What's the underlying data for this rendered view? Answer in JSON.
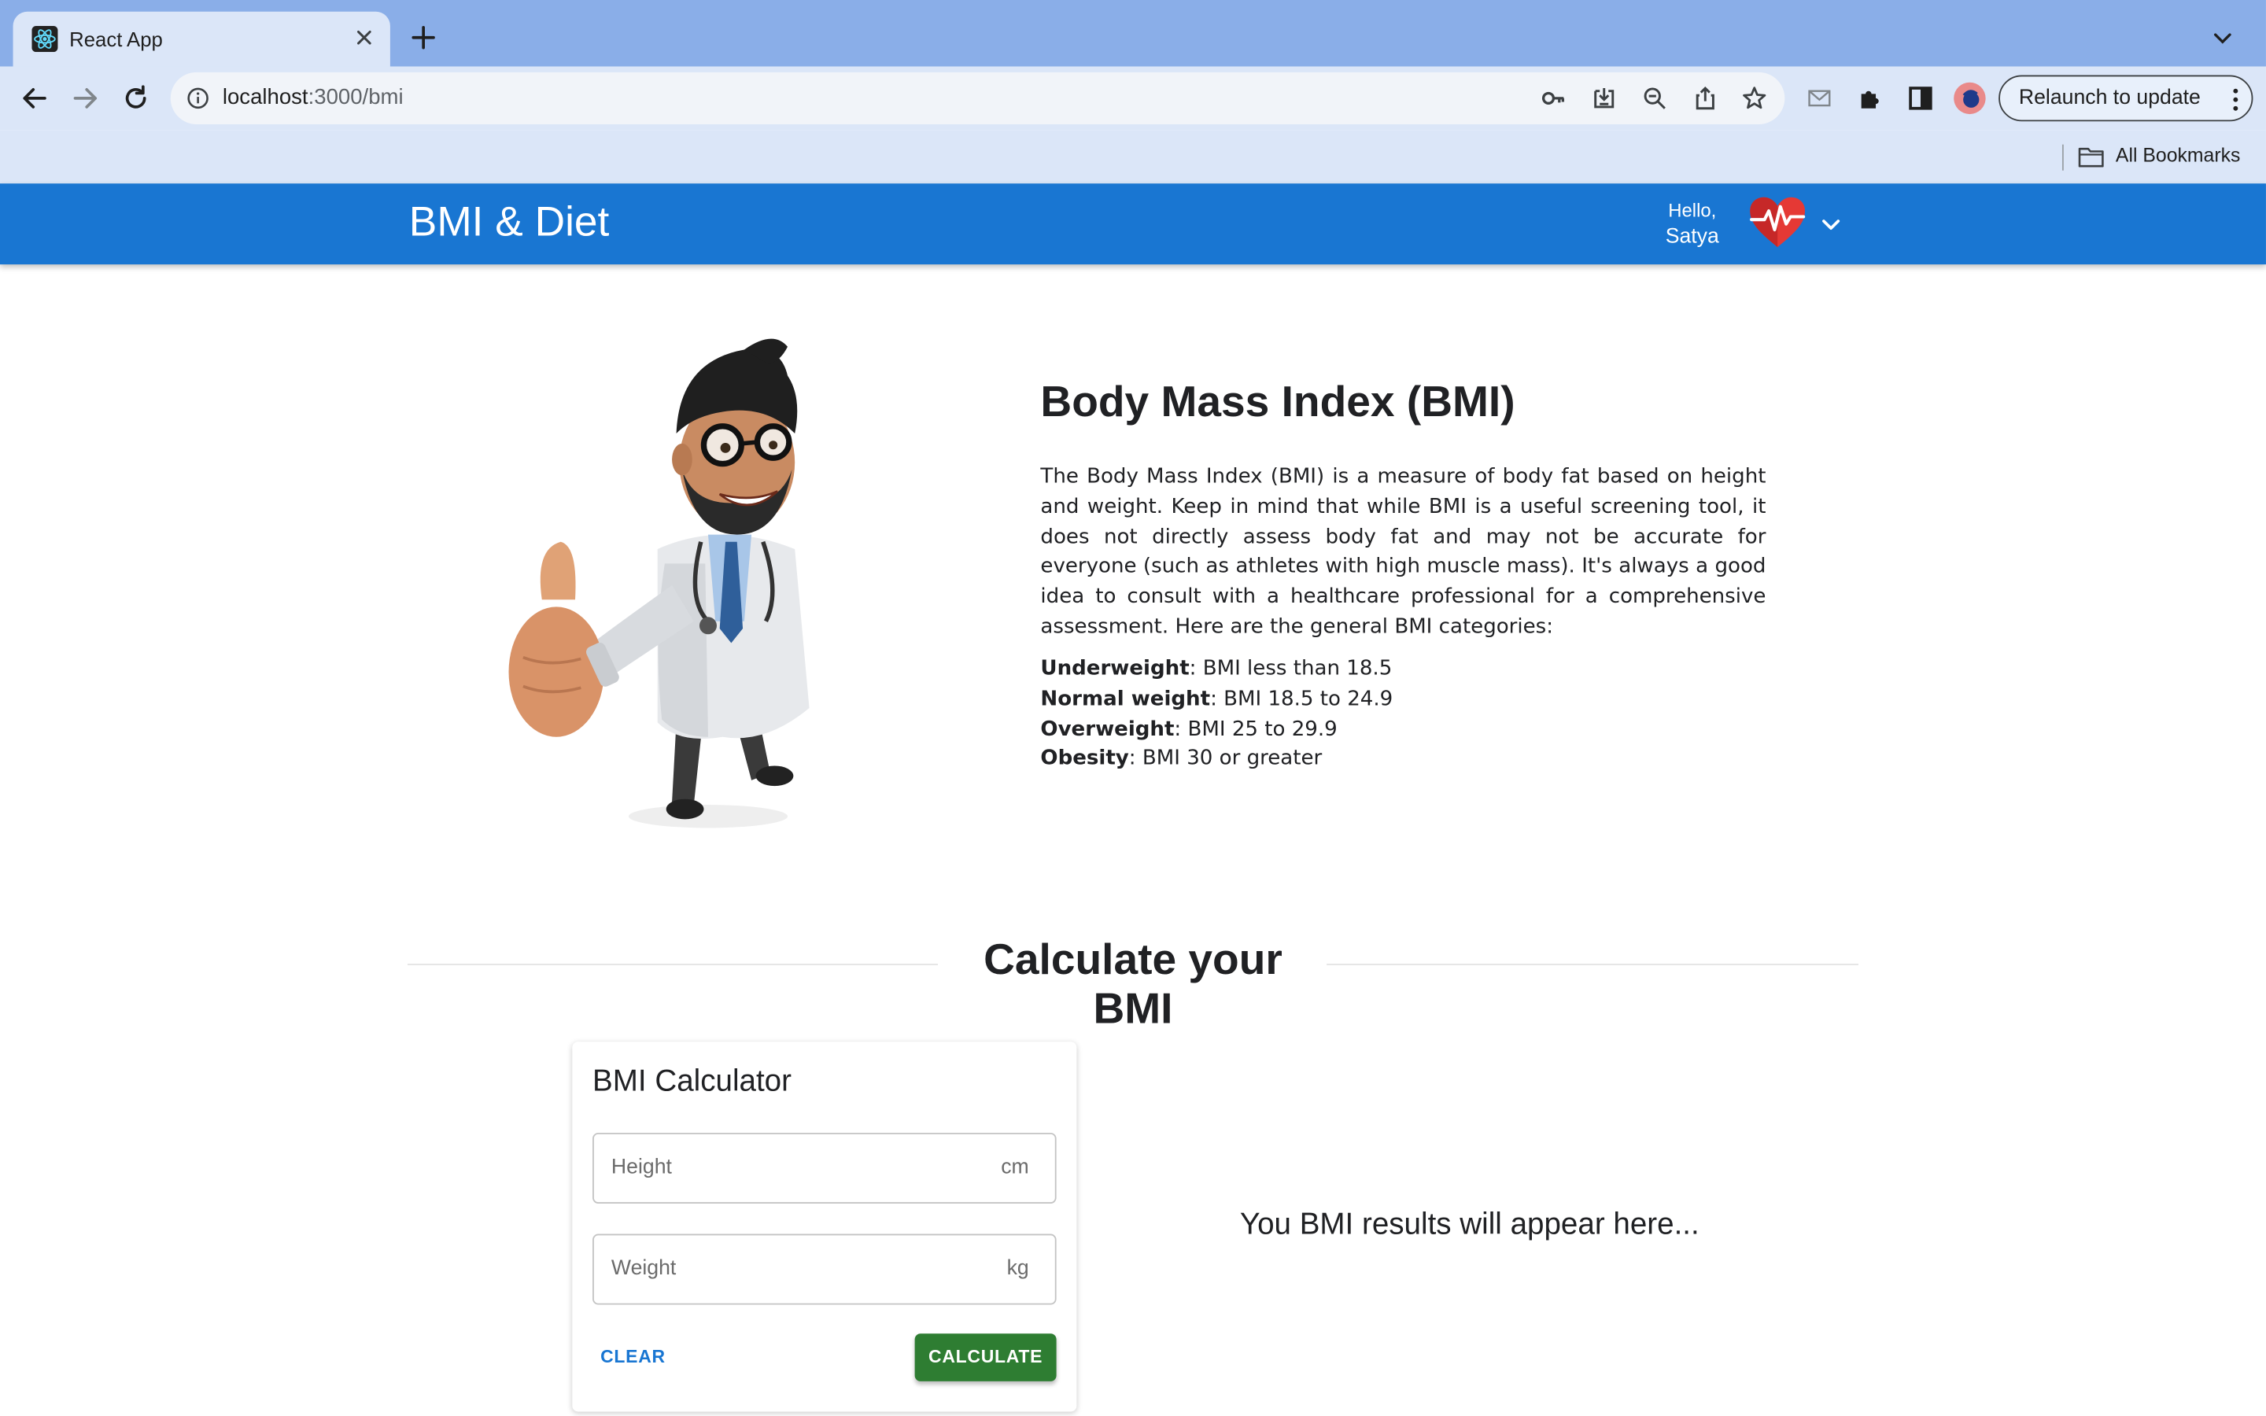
{
  "browser": {
    "tab_title": "React App",
    "url_host": "localhost",
    "url_rest": ":3000/bmi",
    "relaunch_label": "Relaunch to update",
    "bookmarks_label": "All Bookmarks"
  },
  "appbar": {
    "brand": "BMI & Diet",
    "greeting": "Hello,",
    "user_name": "Satya",
    "accent": "#1976d2"
  },
  "hero": {
    "title": "Body Mass Index (BMI)",
    "description": "The Body Mass Index (BMI) is a measure of body fat based on height and weight. Keep in mind that while BMI is a useful screening tool, it does not directly assess body fat and may not be accurate for everyone (such as athletes with high muscle mass). It's always a good idea to consult with a healthcare professional for a comprehensive assessment. Here are the general BMI categories:",
    "categories": [
      {
        "name": "Underweight",
        "range": ": BMI less than 18.5"
      },
      {
        "name": "Normal weight",
        "range": ": BMI 18.5 to 24.9"
      },
      {
        "name": "Overweight",
        "range": ": BMI 25 to 29.9"
      },
      {
        "name": "Obesity",
        "range": ": BMI 30 or greater"
      }
    ]
  },
  "calculator": {
    "section_heading": "Calculate your BMI",
    "card_title": "BMI Calculator",
    "height_placeholder": "Height",
    "height_unit": "cm",
    "weight_placeholder": "Weight",
    "weight_unit": "kg",
    "clear_label": "CLEAR",
    "calculate_label": "CALCULATE",
    "calculate_color": "#2e7d32",
    "result_placeholder": "You BMI results will appear here..."
  }
}
